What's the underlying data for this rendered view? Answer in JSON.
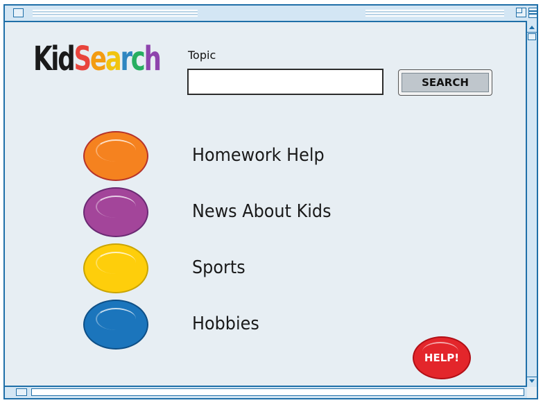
{
  "logo": {
    "kid": "Kid",
    "search_letters": [
      "S",
      "e",
      "a",
      "r",
      "c",
      "h"
    ]
  },
  "search": {
    "label": "Topic",
    "value": "",
    "placeholder": "",
    "button_label": "SEARCH"
  },
  "categories": [
    {
      "label": "Homework Help",
      "color": "#f5821f",
      "border": "#b5332a"
    },
    {
      "label": "News About Kids",
      "color": "#a3459a",
      "border": "#6a2a73"
    },
    {
      "label": "Sports",
      "color": "#fece0b",
      "border": "#c9a400"
    },
    {
      "label": "Hobbies",
      "color": "#1b75bc",
      "border": "#0e4f86"
    }
  ],
  "help": {
    "label": "HELP!"
  },
  "colors": {
    "window_border": "#1f6fa8",
    "window_background": "#e7eef3",
    "help_button": "#e3262b"
  }
}
